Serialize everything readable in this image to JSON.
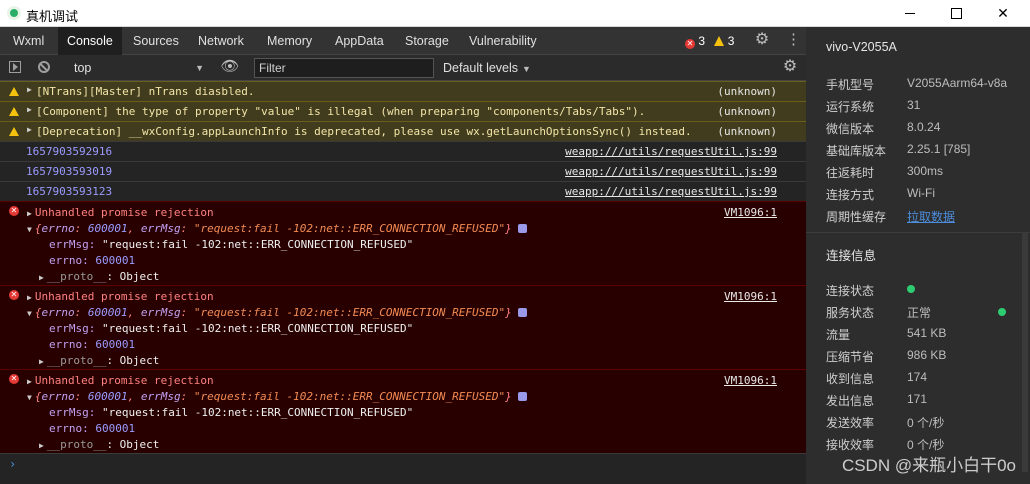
{
  "window": {
    "title": "真机调试",
    "minimize_label": "",
    "maximize_label": "",
    "close_label": "✕"
  },
  "tabs": [
    "Wxml",
    "Console",
    "Sources",
    "Network",
    "Memory",
    "AppData",
    "Storage",
    "Vulnerability"
  ],
  "active_tab": "Console",
  "badges": {
    "errors": "3",
    "warnings": "3"
  },
  "toolbar": {
    "context": "top",
    "filter_placeholder": "Filter",
    "levels": "Default levels"
  },
  "console": {
    "warnings": [
      {
        "message": "[NTrans][Master] nTrans diasbled.",
        "source": "(unknown)"
      },
      {
        "message": "[Component] the type of property \"value\" is illegal (when preparing \"components/Tabs/Tabs\").",
        "source": "(unknown)"
      },
      {
        "message": "[Deprecation] __wxConfig.appLaunchInfo is deprecated, please use wx.getLaunchOptionsSync() instead.",
        "source": "(unknown)"
      }
    ],
    "logs": [
      {
        "value": "1657903592916",
        "source": "weapp:///utils/requestUtil.js:99"
      },
      {
        "value": "1657903593019",
        "source": "weapp:///utils/requestUtil.js:99"
      },
      {
        "value": "1657903593123",
        "source": "weapp:///utils/requestUtil.js:99"
      }
    ],
    "errors": [
      {
        "title": "Unhandled promise rejection",
        "source": "VM1096:1",
        "summary_open": "{",
        "errno_key": "errno",
        "errno_val": "600001",
        "errmsg_key": "errMsg",
        "errmsg_val": "\"request:fail -102:net::ERR_CONNECTION_REFUSED\"",
        "summary_close": "}",
        "errmsg_line_key": "errMsg:",
        "errmsg_line_val": "\"request:fail -102:net::ERR_CONNECTION_REFUSED\"",
        "errno_line_key": "errno:",
        "errno_line_val": "600001",
        "proto_key": "__proto__",
        "proto_val": ": Object"
      },
      {
        "title": "Unhandled promise rejection",
        "source": "VM1096:1",
        "summary_open": "{",
        "errno_key": "errno",
        "errno_val": "600001",
        "errmsg_key": "errMsg",
        "errmsg_val": "\"request:fail -102:net::ERR_CONNECTION_REFUSED\"",
        "summary_close": "}",
        "errmsg_line_key": "errMsg:",
        "errmsg_line_val": "\"request:fail -102:net::ERR_CONNECTION_REFUSED\"",
        "errno_line_key": "errno:",
        "errno_line_val": "600001",
        "proto_key": "__proto__",
        "proto_val": ": Object"
      },
      {
        "title": "Unhandled promise rejection",
        "source": "VM1096:1",
        "summary_open": "{",
        "errno_key": "errno",
        "errno_val": "600001",
        "errmsg_key": "errMsg",
        "errmsg_val": "\"request:fail -102:net::ERR_CONNECTION_REFUSED\"",
        "summary_close": "}",
        "errmsg_line_key": "errMsg:",
        "errmsg_line_val": "\"request:fail -102:net::ERR_CONNECTION_REFUSED\"",
        "errno_line_key": "errno:",
        "errno_line_val": "600001",
        "proto_key": "__proto__",
        "proto_val": ": Object"
      }
    ],
    "prompt": "›"
  },
  "panel": {
    "device": "vivo-V2055A",
    "info": [
      {
        "key": "手机型号",
        "value": "V2055Aarm64-v8a"
      },
      {
        "key": "运行系统",
        "value": "31"
      },
      {
        "key": "微信版本",
        "value": "8.0.24"
      },
      {
        "key": "基础库版本",
        "value": "2.25.1 [785]"
      },
      {
        "key": "往返耗时",
        "value": "300ms"
      },
      {
        "key": "连接方式",
        "value": "Wi-Fi"
      },
      {
        "key": "周期性缓存",
        "value": "拉取数据"
      }
    ],
    "connection_title": "连接信息",
    "connection": [
      {
        "key": "连接状态",
        "value": ""
      },
      {
        "key": "服务状态",
        "value": "正常"
      },
      {
        "key": "流量",
        "value": "541 KB"
      },
      {
        "key": "压缩节省",
        "value": "986 KB"
      },
      {
        "key": "收到信息",
        "value": "174"
      },
      {
        "key": "发出信息",
        "value": "171"
      },
      {
        "key": "发送效率",
        "value": "0 个/秒"
      },
      {
        "key": "接收效率",
        "value": "0 个/秒"
      }
    ]
  },
  "watermark": "CSDN @来瓶小白干0o",
  "colors": {
    "warning_bg": "#413c1d",
    "error_bg": "#290000",
    "accent_link": "#4d8ddb",
    "status_green": "#2ecc71"
  }
}
